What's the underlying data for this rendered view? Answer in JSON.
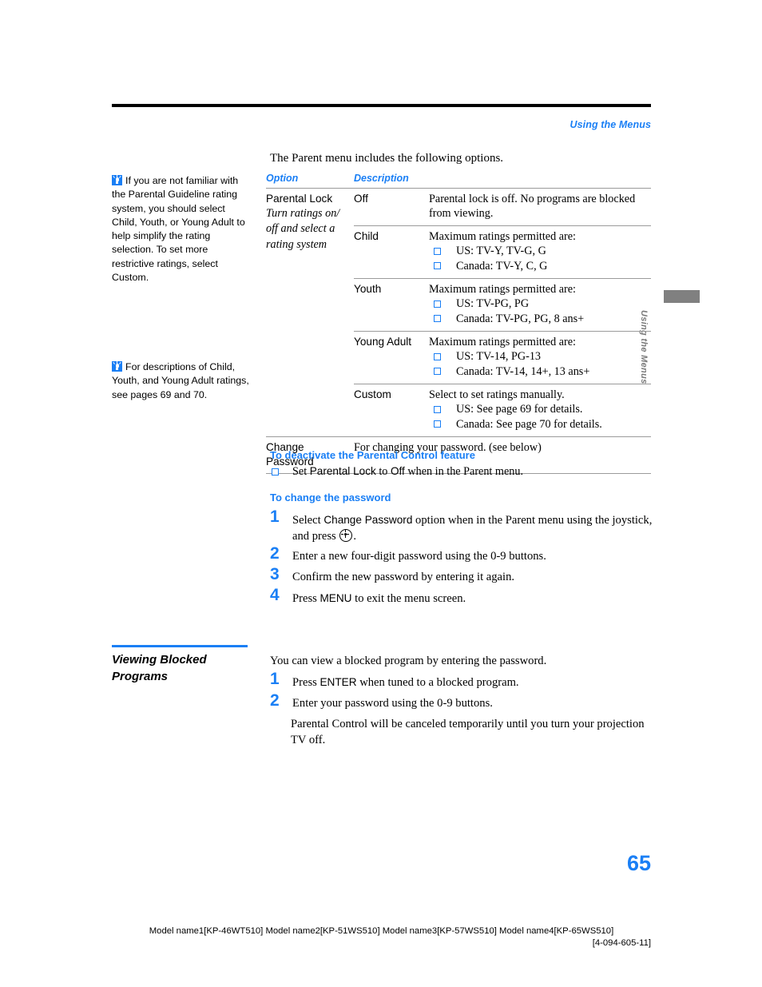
{
  "header": {
    "running_head": "Using the Menus"
  },
  "side_tab": {
    "label": "Using the Menus"
  },
  "tips": [
    {
      "icon": "lightbulb-tip-icon",
      "text": "If you are not familiar with the Parental Guideline rating system, you should select Child, Youth, or Young Adult to help simplify the rating selection. To set more restrictive ratings, select Custom."
    },
    {
      "icon": "lightbulb-tip-icon",
      "text": "For descriptions of Child, Youth, and Young Adult ratings, see pages 69 and 70."
    }
  ],
  "main": {
    "intro": "The Parent menu includes the following options.",
    "table": {
      "headers": {
        "option": "Option",
        "description": "Description"
      },
      "rows": [
        {
          "option_name": "Parental Lock",
          "option_sub": "Turn ratings on/ off and select a rating system",
          "value": "Off",
          "lead": "Parental lock is off. No programs are blocked from viewing.",
          "bullets": []
        },
        {
          "option_name": "",
          "option_sub": "",
          "value": "Child",
          "lead": "Maximum ratings permitted are:",
          "bullets": [
            "US: TV-Y, TV-G, G",
            "Canada: TV-Y, C, G"
          ]
        },
        {
          "option_name": "",
          "option_sub": "",
          "value": "Youth",
          "lead": "Maximum ratings permitted are:",
          "bullets": [
            "US: TV-PG, PG",
            "Canada: TV-PG, PG, 8 ans+"
          ]
        },
        {
          "option_name": "",
          "option_sub": "",
          "value": "Young Adult",
          "lead": "Maximum ratings permitted are:",
          "bullets": [
            "US: TV-14, PG-13",
            "Canada: TV-14, 14+, 13 ans+"
          ]
        },
        {
          "option_name": "",
          "option_sub": "",
          "value": "Custom",
          "lead": "Select to set ratings manually.",
          "bullets": [
            "US: See page 69 for details.",
            "Canada: See page 70 for details."
          ]
        },
        {
          "option_name": "Change Password",
          "option_sub": "",
          "value": "",
          "lead": "For changing your password. (see below)",
          "bullets": []
        }
      ]
    },
    "deactivate": {
      "heading": "To deactivate the Parental Control feature",
      "item_pre": "Set ",
      "item_term1": "Parental Lock",
      "item_mid": " to ",
      "item_term2": "Off",
      "item_post": " when in the Parent menu."
    },
    "change_password": {
      "heading": "To change the password",
      "steps": [
        {
          "number": "1",
          "pre": "Select ",
          "term": "Change Password",
          "post": " option when in the Parent menu using the joystick, and press ",
          "icon": "joystick-button-icon",
          "tail": "."
        },
        {
          "number": "2",
          "pre": "Enter a new four-digit password using the 0-9 buttons.",
          "term": "",
          "post": "",
          "tail": ""
        },
        {
          "number": "3",
          "pre": "Confirm the new password by entering it again.",
          "term": "",
          "post": "",
          "tail": ""
        },
        {
          "number": "4",
          "pre": "Press ",
          "term": "MENU",
          "post": " to exit the menu screen.",
          "tail": ""
        }
      ]
    },
    "viewing_blocked": {
      "title": "Viewing Blocked Programs",
      "intro": "You can view a blocked program by entering the password.",
      "steps": [
        {
          "number": "1",
          "pre": "Press ",
          "term": "ENTER",
          "post": " when tuned to a blocked program."
        },
        {
          "number": "2",
          "pre": "Enter your password using the 0-9 buttons.",
          "term": "",
          "post": ""
        }
      ],
      "note": "Parental Control will be canceled temporarily until you turn your projection TV off."
    }
  },
  "page_number": "65",
  "footer": {
    "models": "Model name1[KP-46WT510] Model name2[KP-51WS510] Model name3[KP-57WS510] Model name4[KP-65WS510]",
    "code": "[4-094-605-11]"
  },
  "colors": {
    "accent_blue": "#1a7ff5",
    "rule_gray": "#9b9b9b",
    "tab_gray": "#808080"
  }
}
